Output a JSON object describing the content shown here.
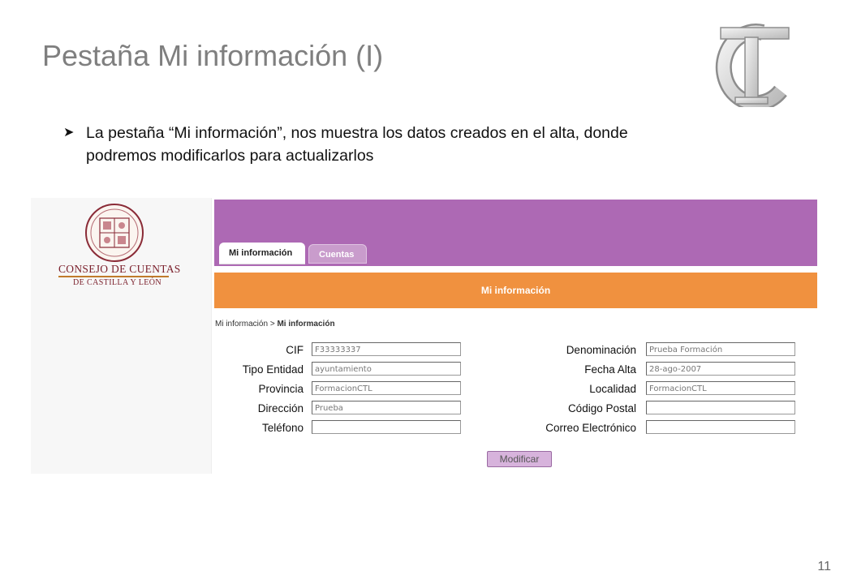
{
  "slide": {
    "title": "Pestaña Mi información (I)",
    "bullet_text": "La pestaña “Mi información”, nos muestra los datos creados en el alta, donde podremos modificarlos para actualizarlos",
    "page_number": "11"
  },
  "colors": {
    "header_purple": "#ad69b4",
    "orange_bar": "#f0913f",
    "button_fill": "#d7b3dc"
  },
  "app": {
    "org_name_line1": "CONSEJO DE CUENTAS",
    "org_name_line2": "DE CASTILLA Y LEÓN",
    "tabs": [
      {
        "label": "Mi información",
        "active": true
      },
      {
        "label": "Cuentas",
        "active": false
      }
    ],
    "section_title": "Mi información",
    "breadcrumb": {
      "parent": "Mi información",
      "separator": ">",
      "current": "Mi información"
    },
    "form": {
      "left": [
        {
          "label": "CIF",
          "value": "F33333337"
        },
        {
          "label": "Tipo Entidad",
          "value": "ayuntamiento"
        },
        {
          "label": "Provincia",
          "value": "FormacionCTL"
        },
        {
          "label": "Dirección",
          "value": "Prueba"
        },
        {
          "label": "Teléfono",
          "value": ""
        }
      ],
      "right": [
        {
          "label": "Denominación",
          "value": "Prueba Formación"
        },
        {
          "label": "Fecha Alta",
          "value": "28-ago-2007"
        },
        {
          "label": "Localidad",
          "value": "FormacionCTL"
        },
        {
          "label": "Código Postal",
          "value": ""
        },
        {
          "label": "Correo Electrónico",
          "value": ""
        }
      ]
    },
    "modify_button": "Modificar"
  }
}
